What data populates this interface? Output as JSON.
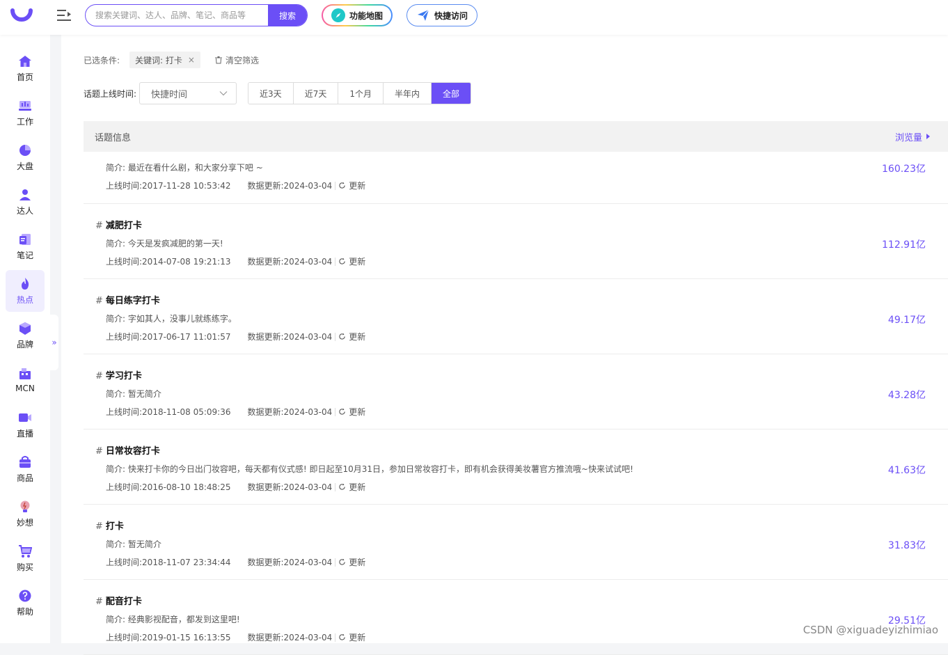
{
  "header": {
    "search_placeholder": "搜索关键词、达人、品牌、笔记、商品等",
    "search_button": "搜索",
    "feature_map": "功能地图",
    "quick_access": "快捷访问"
  },
  "sidebar": {
    "items": [
      {
        "label": "首页",
        "icon": "home-icon"
      },
      {
        "label": "工作",
        "icon": "workbench-icon"
      },
      {
        "label": "大盘",
        "icon": "pie-chart-icon"
      },
      {
        "label": "达人",
        "icon": "user-icon"
      },
      {
        "label": "笔记",
        "icon": "note-icon"
      },
      {
        "label": "热点",
        "icon": "flame-icon"
      },
      {
        "label": "品牌",
        "icon": "brand-icon"
      },
      {
        "label": "MCN",
        "icon": "building-icon"
      },
      {
        "label": "直播",
        "icon": "live-camera-icon"
      },
      {
        "label": "商品",
        "icon": "shopping-bag-icon"
      },
      {
        "label": "妙想",
        "icon": "lightbulb-icon"
      },
      {
        "label": "购买",
        "icon": "cart-icon"
      },
      {
        "label": "帮助",
        "icon": "help-icon"
      }
    ],
    "active_index": 5,
    "collapse_glyph": "»"
  },
  "filters": {
    "label": "已选条件:",
    "chip": "关键词: 打卡",
    "chip_close": "×",
    "clear": "清空筛选"
  },
  "time_filter": {
    "label": "话题上线时间:",
    "select_value": "快捷时间",
    "segments": [
      "近3天",
      "近7天",
      "1个月",
      "半年内",
      "全部"
    ],
    "active_index": 4
  },
  "table": {
    "col_info": "话题信息",
    "col_views": "浏览量",
    "desc_prefix": "简介:",
    "online_prefix": "上线时间:",
    "update_prefix": "数据更新:",
    "refresh_label": "更新",
    "rows": [
      {
        "title": "",
        "desc": "最近在看什么剧，和大家分享下吧 ~",
        "online": "2017-11-28 10:53:42",
        "updated": "2024-03-04",
        "views": "160.23亿"
      },
      {
        "title": "减肥打卡",
        "desc": "今天是发疯减肥的第一天!",
        "online": "2014-07-08 19:21:13",
        "updated": "2024-03-04",
        "views": "112.91亿"
      },
      {
        "title": "每日练字打卡",
        "desc": "字如其人，没事儿就练练字。",
        "online": "2017-06-17 11:01:57",
        "updated": "2024-03-04",
        "views": "49.17亿"
      },
      {
        "title": "学习打卡",
        "desc": "暂无简介",
        "online": "2018-11-08 05:09:36",
        "updated": "2024-03-04",
        "views": "43.28亿"
      },
      {
        "title": "日常妆容打卡",
        "desc": "快来打卡你的今日出门妆容吧，每天都有仪式感! 即日起至10月31日，参加日常妆容打卡，即有机会获得美妆薯官方推流哦~快来试试吧!",
        "online": "2016-08-10 18:48:25",
        "updated": "2024-03-04",
        "views": "41.63亿"
      },
      {
        "title": "打卡",
        "desc": "暂无简介",
        "online": "2018-11-07 23:34:44",
        "updated": "2024-03-04",
        "views": "31.83亿"
      },
      {
        "title": "配音打卡",
        "desc": "经典影视配音，都发到这里吧!",
        "online": "2019-01-15 16:13:55",
        "updated": "2024-03-04",
        "views": "29.51亿"
      }
    ]
  },
  "watermark": "CSDN @xiguadeyizhimiao",
  "colors": {
    "accent": "#6b4ff6",
    "quick_border": "#5a8cf0"
  }
}
